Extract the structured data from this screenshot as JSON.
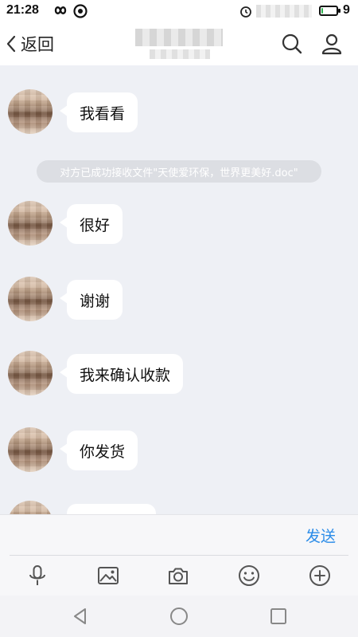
{
  "status_bar": {
    "time": "21:28",
    "battery_level": "9",
    "battery_fraction": 0.09
  },
  "header": {
    "back_label": "返回"
  },
  "messages": [
    {
      "text": "我看看"
    },
    {
      "text": "很好"
    },
    {
      "text": "谢谢"
    },
    {
      "text": "我来确认收款"
    },
    {
      "text": "你发货"
    },
    {
      "text": ""
    }
  ],
  "system_notice": {
    "text": "对方已成功接收文件\"天使爱环保，世界更美好.doc\""
  },
  "composer": {
    "input_value": "",
    "send_label": "发送"
  },
  "toolbar": {
    "icons": [
      "microphone-icon",
      "image-icon",
      "camera-icon",
      "emoji-icon",
      "plus-icon"
    ]
  },
  "nav": {
    "icons": [
      "back-triangle-icon",
      "home-circle-icon",
      "recents-square-icon"
    ]
  },
  "colors": {
    "chat_background": "#eef0f5",
    "bubble": "#ffffff",
    "send_accent": "#2b8ce8",
    "notice_background": "#dcdee3"
  }
}
